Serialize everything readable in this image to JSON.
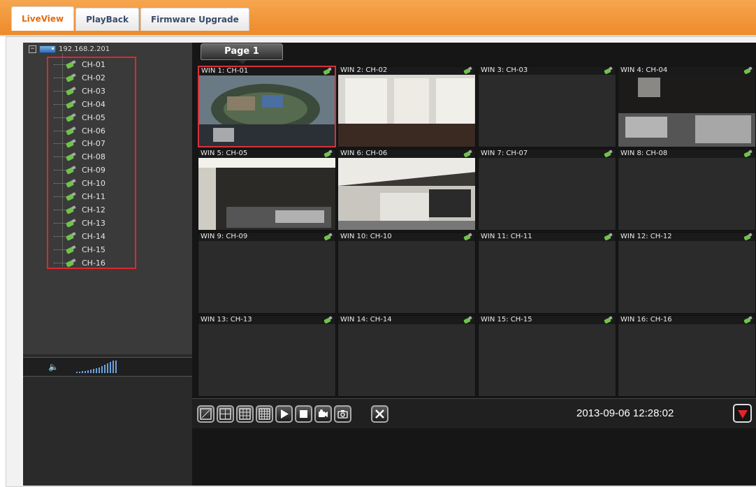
{
  "tabs": [
    {
      "label": "LiveView",
      "active": true
    },
    {
      "label": "PlayBack",
      "active": false
    },
    {
      "label": "Firmware Upgrade",
      "active": false
    }
  ],
  "tree": {
    "root_label": "192.168.2.201",
    "channels": [
      "CH-01",
      "CH-02",
      "CH-03",
      "CH-04",
      "CH-05",
      "CH-06",
      "CH-07",
      "CH-08",
      "CH-09",
      "CH-10",
      "CH-11",
      "CH-12",
      "CH-13",
      "CH-14",
      "CH-15",
      "CH-16"
    ]
  },
  "page_label": "Page 1",
  "windows": [
    "WIN 1: CH-01",
    "WIN 2: CH-02",
    "WIN 3: CH-03",
    "WIN 4: CH-04",
    "WIN 5: CH-05",
    "WIN 6: CH-06",
    "WIN 7: CH-07",
    "WIN 8: CH-08",
    "WIN 9: CH-09",
    "WIN 10: CH-10",
    "WIN 11: CH-11",
    "WIN 12: CH-12",
    "WIN 13: CH-13",
    "WIN 14: CH-14",
    "WIN 15: CH-15",
    "WIN 16: CH-16"
  ],
  "selected_window": "WIN 1: CH-01",
  "datetime": "2013-09-06 12:28:02",
  "icons": {
    "speaker": "speaker-icon",
    "volume": "volume-level-icon",
    "layout_1": "layout-1x1-icon",
    "layout_4": "layout-2x2-icon",
    "layout_9": "layout-3x3-icon",
    "layout_16": "layout-4x4-icon",
    "play": "play-icon",
    "stop": "stop-icon",
    "record": "record-camera-icon",
    "snapshot": "snapshot-icon",
    "settings": "tools-icon",
    "more": "dropdown-arrow-icon"
  },
  "colors": {
    "accent": "#ee8a2a",
    "selection": "#e3252d",
    "active_tab_text": "#e36b10"
  }
}
